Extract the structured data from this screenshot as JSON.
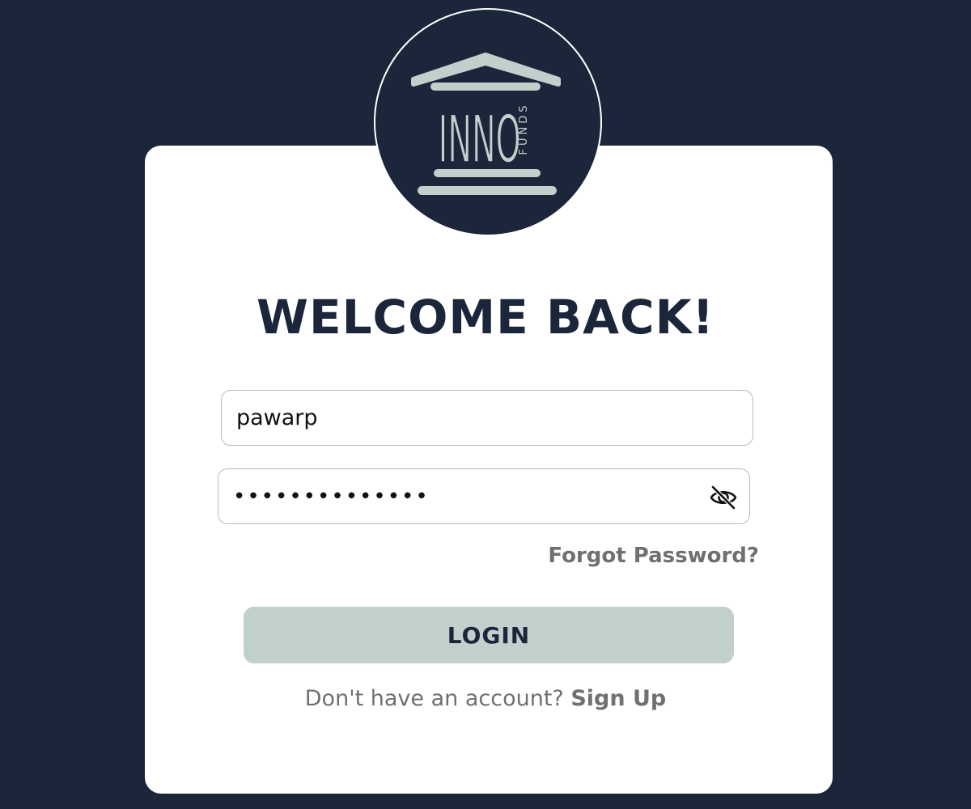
{
  "logo": {
    "brand_main": "INNO",
    "brand_sub": "FUNDS",
    "icon": "pillar-building-icon"
  },
  "heading": "WELCOME BACK!",
  "username": {
    "value": "pawarp"
  },
  "password": {
    "value": "••••••••••••••",
    "toggle_icon": "eye-off-icon"
  },
  "forgot_password_label": "Forgot Password?",
  "login_label": "LOGIN",
  "signup": {
    "prompt": "Don't have an account? ",
    "link_label": "Sign Up"
  },
  "colors": {
    "background": "#1b263b",
    "card": "#ffffff",
    "accent": "#c1cfcd",
    "muted_text": "#707070"
  }
}
